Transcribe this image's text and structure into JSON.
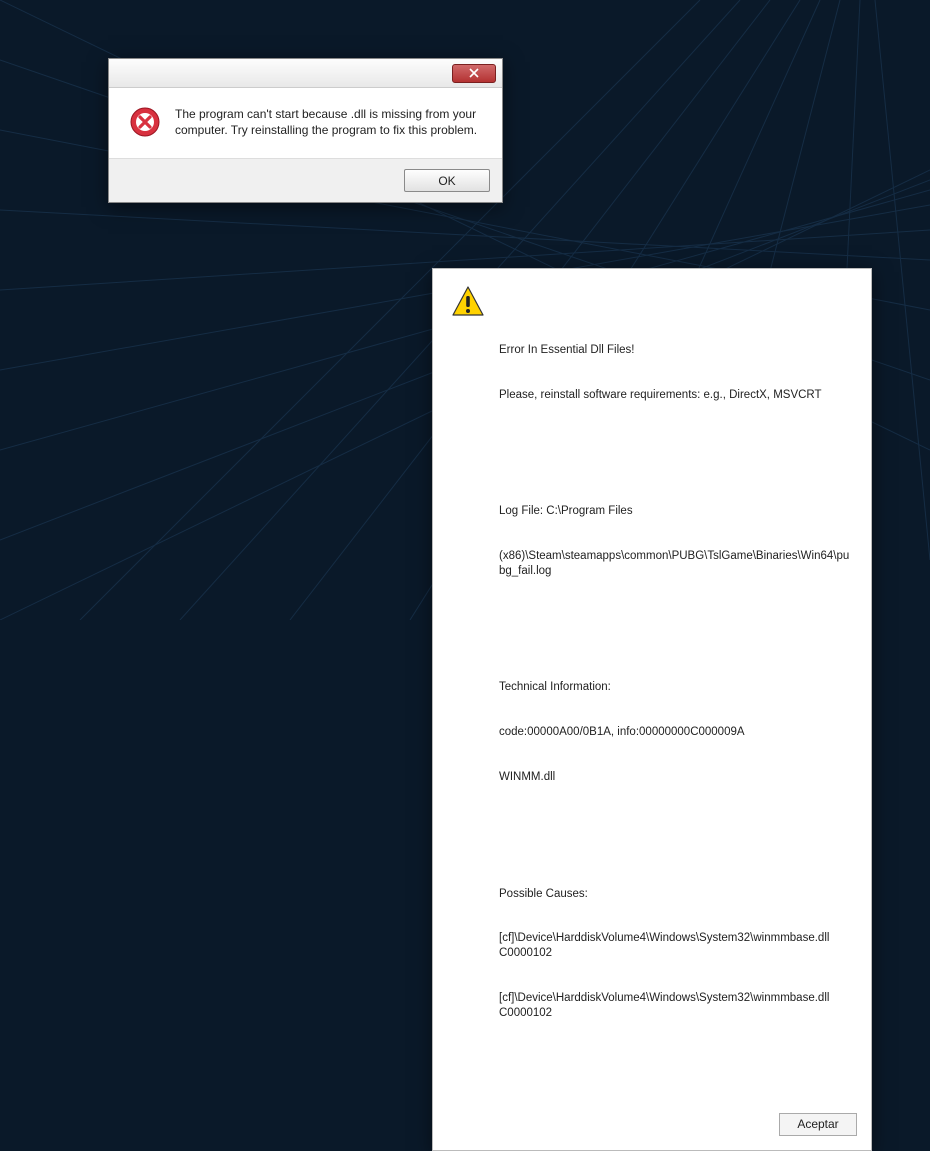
{
  "dialog1": {
    "message": "The program can't start because          .dll is missing from your computer. Try reinstalling the program to fix this problem.",
    "ok_label": "OK"
  },
  "dialog2": {
    "title": "Error In Essential Dll Files!",
    "subtitle": "Please, reinstall software requirements: e.g., DirectX, MSVCRT",
    "log_label": "Log File: C:\\Program Files",
    "log_path": "(x86)\\Steam\\steamapps\\common\\PUBG\\TslGame\\Binaries\\Win64\\pubg_fail.log",
    "tech_label": "Technical Information:",
    "tech_code": "code:00000A00/0B1A, info:00000000C000009A",
    "tech_dll": "WINMM.dll",
    "causes_label": "Possible Causes:",
    "cause1": "[cf]\\Device\\HarddiskVolume4\\Windows\\System32\\winmmbase.dll C0000102",
    "cause2": "[cf]\\Device\\HarddiskVolume4\\Windows\\System32\\winmmbase.dll C0000102",
    "accept_label": "Aceptar"
  }
}
